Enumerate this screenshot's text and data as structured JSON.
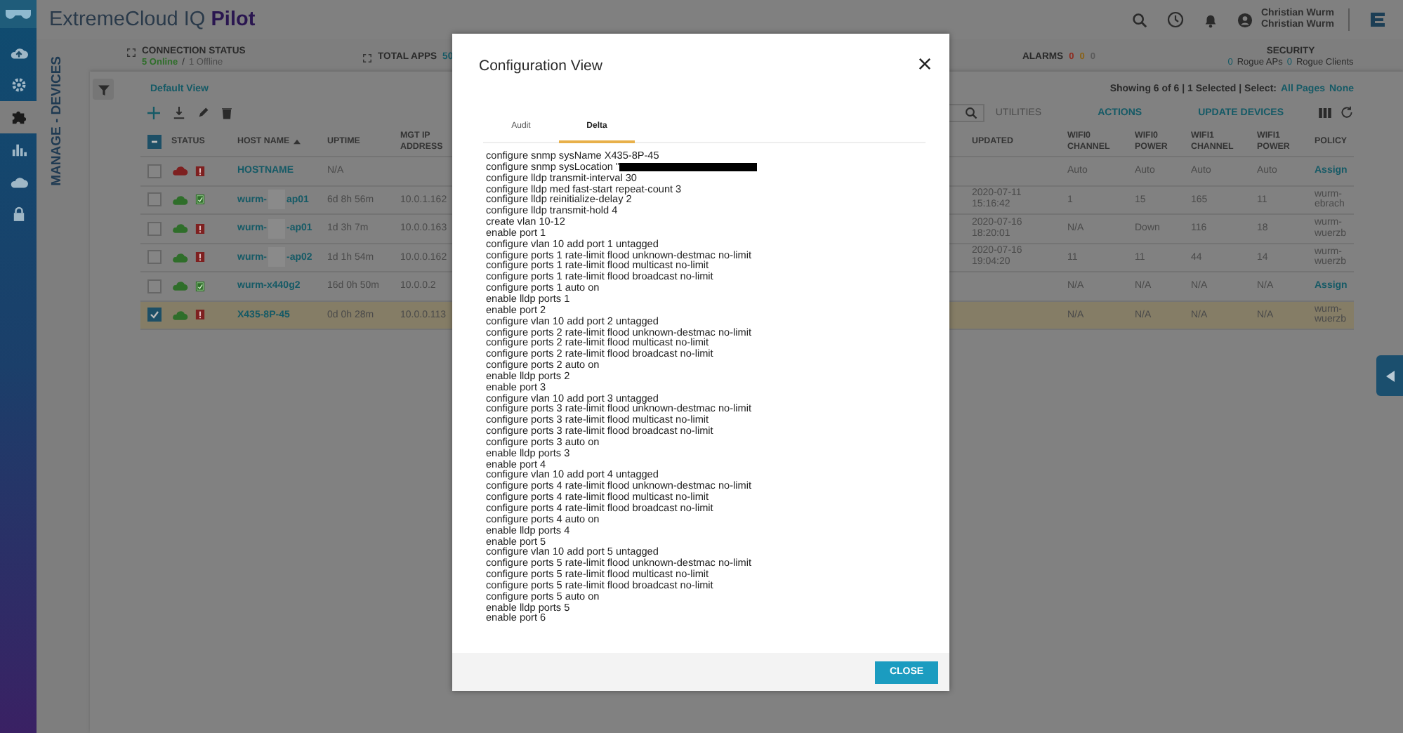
{
  "app": {
    "brand": "ExtremeCloud IQ",
    "brand_bold": "Pilot"
  },
  "user": {
    "name": "Christian Wurm",
    "account": "Christian Wurm"
  },
  "nav": [
    {
      "kind": "cloud",
      "selected": false
    },
    {
      "kind": "gear",
      "selected": false
    },
    {
      "kind": "puzzle",
      "selected": true
    },
    {
      "kind": "chart",
      "selected": false
    },
    {
      "kind": "cloud-plain",
      "selected": false
    },
    {
      "kind": "lock",
      "selected": false
    }
  ],
  "page_title": "MANAGE - DEVICES",
  "stats": {
    "connection": {
      "label": "CONNECTION STATUS",
      "online": "5 Online",
      "separator": "/",
      "offline": "1 Offline"
    },
    "total_apps": {
      "label": "TOTAL APPS",
      "value": "50"
    },
    "alarms": {
      "label": "ALARMS",
      "values": [
        {
          "text": "0",
          "color": "#8f2a1e"
        },
        {
          "text": "0",
          "color": "#8a6215"
        },
        {
          "text": "0",
          "color": "#5a5a5a"
        }
      ]
    },
    "security": {
      "label": "SECURITY",
      "rogue_aps": "0",
      "rogue_aps_label": "Rogue APs",
      "rogue_clients": "0",
      "rogue_clients_label": "Rogue Clients"
    }
  },
  "toolbar": {
    "view": "Default View",
    "showing": "Showing 6 of 6 | 1 Selected | Select:",
    "all_pages": "All Pages",
    "none": "None",
    "actions": [
      {
        "label": "UTILITIES",
        "disabled": true
      },
      {
        "label": "ACTIONS",
        "disabled": false
      },
      {
        "label": "UPDATE DEVICES",
        "disabled": false
      }
    ]
  },
  "table": {
    "select_all": {
      "indeterminate": true
    },
    "left_columns": [
      "STATUS",
      "HOST NAME",
      "UPTIME",
      "MGT IP ADDRESS"
    ],
    "right_columns": [
      "UPDATED",
      "WIFI0 CHANNEL",
      "WIFI0 POWER",
      "WIFI1 CHANNEL",
      "WIFI1 POWER",
      "POLICY"
    ],
    "rows": [
      {
        "selected": false,
        "online": false,
        "config_ok": false,
        "host": "HOSTNAME",
        "uptime": "N/A",
        "ip": "",
        "updated": "",
        "wifi0_channel": "Auto",
        "wifi0_power": "Auto",
        "wifi1_channel": "Auto",
        "wifi1_power": "Auto",
        "policy": "Assign",
        "policy_link": true
      },
      {
        "selected": false,
        "online": true,
        "config_ok": true,
        "host": "wurm-",
        "host_end": "ap01",
        "redacted": true,
        "uptime": "6d 8h 56m",
        "ip": "10.0.1.162",
        "updated": "2020-07-11 15:16:42",
        "wifi0_channel": "1",
        "wifi0_power": "15",
        "wifi1_channel": "165",
        "wifi1_power": "11",
        "policy": "wurm-ebrach",
        "policy_link": false
      },
      {
        "selected": false,
        "online": true,
        "config_ok": false,
        "host": "wurm-",
        "host_end": "-ap01",
        "redacted": true,
        "uptime": "1d 3h 7m",
        "ip": "10.0.0.163",
        "updated": "2020-07-16 18:20:01",
        "wifi0_channel": "N/A",
        "wifi0_power": "Down",
        "wifi1_channel": "116",
        "wifi1_power": "18",
        "policy": "wurm-wuerzb",
        "policy_link": false
      },
      {
        "selected": false,
        "online": true,
        "config_ok": false,
        "host": "wurm-",
        "host_end": "-ap02",
        "redacted": true,
        "uptime": "1d 1h 54m",
        "ip": "10.0.0.162",
        "updated": "2020-07-16 19:04:20",
        "wifi0_channel": "11",
        "wifi0_power": "11",
        "wifi1_channel": "44",
        "wifi1_power": "14",
        "policy": "wurm-wuerzb",
        "policy_link": false
      },
      {
        "selected": false,
        "online": true,
        "config_ok": true,
        "host": "wurm-x440g2",
        "uptime": "16d 0h 50m",
        "ip": "10.0.0.2",
        "updated": "",
        "wifi0_channel": "N/A",
        "wifi0_power": "N/A",
        "wifi1_channel": "N/A",
        "wifi1_power": "N/A",
        "policy": "Assign",
        "policy_link": true
      },
      {
        "selected": true,
        "online": true,
        "config_ok": false,
        "host": "X435-8P-45",
        "uptime": "0d 0h 28m",
        "ip": "10.0.0.113",
        "updated": "",
        "wifi0_channel": "N/A",
        "wifi0_power": "N/A",
        "wifi1_channel": "N/A",
        "wifi1_power": "N/A",
        "policy": "wurm-wuerzb",
        "policy_link": false
      }
    ]
  },
  "modal": {
    "title": "Configuration View",
    "tabs": [
      {
        "label": "Audit",
        "selected": false
      },
      {
        "label": "Delta",
        "selected": true
      }
    ],
    "lines": [
      {
        "text": "configure snmp sysName X435-8P-45"
      },
      {
        "text": "configure snmp sysLocation \"",
        "redacted": true
      },
      {
        "text": "configure lldp transmit-interval 30"
      },
      {
        "text": "configure lldp med fast-start repeat-count 3"
      },
      {
        "text": "configure lldp reinitialize-delay 2"
      },
      {
        "text": "configure lldp transmit-hold 4"
      },
      {
        "text": "create vlan 10-12"
      },
      {
        "text": "enable port 1"
      },
      {
        "text": "configure vlan 10 add port 1 untagged"
      },
      {
        "text": "configure ports 1 rate-limit flood unknown-destmac no-limit"
      },
      {
        "text": "configure ports 1 rate-limit flood multicast no-limit"
      },
      {
        "text": "configure ports 1 rate-limit flood broadcast no-limit"
      },
      {
        "text": "configure ports 1 auto on"
      },
      {
        "text": "enable lldp ports 1"
      },
      {
        "text": "enable port 2"
      },
      {
        "text": "configure vlan 10 add port 2 untagged"
      },
      {
        "text": "configure ports 2 rate-limit flood unknown-destmac no-limit"
      },
      {
        "text": "configure ports 2 rate-limit flood multicast no-limit"
      },
      {
        "text": "configure ports 2 rate-limit flood broadcast no-limit"
      },
      {
        "text": "configure ports 2 auto on"
      },
      {
        "text": "enable lldp ports 2"
      },
      {
        "text": "enable port 3"
      },
      {
        "text": "configure vlan 10 add port 3 untagged"
      },
      {
        "text": "configure ports 3 rate-limit flood unknown-destmac no-limit"
      },
      {
        "text": "configure ports 3 rate-limit flood multicast no-limit"
      },
      {
        "text": "configure ports 3 rate-limit flood broadcast no-limit"
      },
      {
        "text": "configure ports 3 auto on"
      },
      {
        "text": "enable lldp ports 3"
      },
      {
        "text": "enable port 4"
      },
      {
        "text": "configure vlan 10 add port 4 untagged"
      },
      {
        "text": "configure ports 4 rate-limit flood unknown-destmac no-limit"
      },
      {
        "text": "configure ports 4 rate-limit flood multicast no-limit"
      },
      {
        "text": "configure ports 4 rate-limit flood broadcast no-limit"
      },
      {
        "text": "configure ports 4 auto on"
      },
      {
        "text": "enable lldp ports 4"
      },
      {
        "text": "enable port 5"
      },
      {
        "text": "configure vlan 10 add port 5 untagged"
      },
      {
        "text": "configure ports 5 rate-limit flood unknown-destmac no-limit"
      },
      {
        "text": "configure ports 5 rate-limit flood multicast no-limit"
      },
      {
        "text": "configure ports 5 rate-limit flood broadcast no-limit"
      },
      {
        "text": "configure ports 5 auto on"
      },
      {
        "text": "enable lldp ports 5"
      },
      {
        "text": "enable port 6"
      }
    ],
    "close_button": "CLOSE"
  }
}
